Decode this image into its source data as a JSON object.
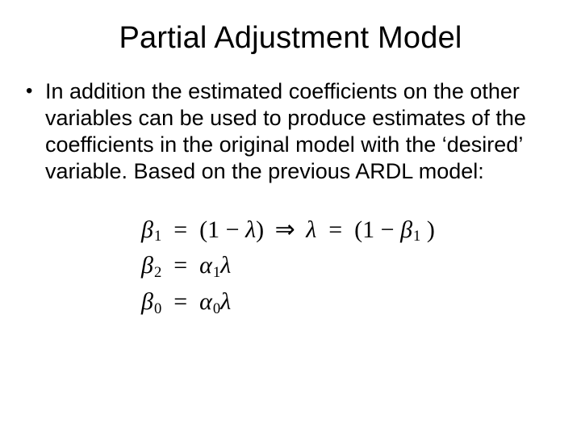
{
  "title": "Partial Adjustment Model",
  "bullet": {
    "marker": "•",
    "text": "In addition the estimated coefficients on the other variables can be used to produce estimates of the coefficients in the original model with the ‘desired’ variable. Based on the previous ARDL model:"
  },
  "equations": {
    "beta": "β",
    "alpha": "α",
    "lambda": "λ",
    "eq": "=",
    "open": "(",
    "close": ")",
    "one": "1",
    "minus": "−",
    "implies": "⇒",
    "sub0": "0",
    "sub1": "1",
    "sub2": "2"
  }
}
